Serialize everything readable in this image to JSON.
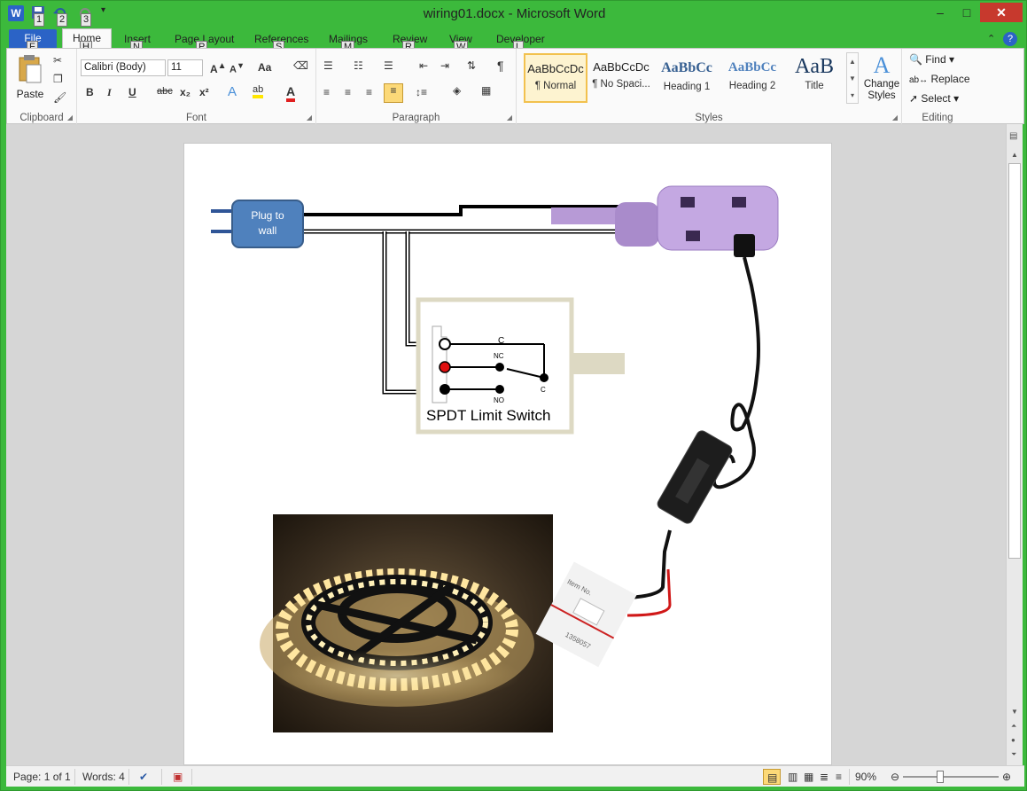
{
  "app": {
    "title": "wiring01.docx - Microsoft Word",
    "window_buttons": [
      "–",
      "□",
      "✕"
    ]
  },
  "qat": {
    "keytips": [
      "1",
      "2",
      "3"
    ]
  },
  "tabs": [
    {
      "label": "File",
      "keytip": "F"
    },
    {
      "label": "Home",
      "keytip": "H"
    },
    {
      "label": "Insert",
      "keytip": "N"
    },
    {
      "label": "Page Layout",
      "keytip": "P"
    },
    {
      "label": "References",
      "keytip": "S"
    },
    {
      "label": "Mailings",
      "keytip": "M"
    },
    {
      "label": "Review",
      "keytip": "R"
    },
    {
      "label": "View",
      "keytip": "W"
    },
    {
      "label": "Developer",
      "keytip": "L"
    }
  ],
  "ribbon": {
    "clipboard": {
      "label": "Clipboard",
      "paste": "Paste"
    },
    "font": {
      "label": "Font",
      "font_name": "Calibri (Body)",
      "font_size": "11",
      "case": "Aa"
    },
    "paragraph": {
      "label": "Paragraph"
    },
    "styles": {
      "label": "Styles",
      "items": [
        {
          "sample": "AaBbCcDc",
          "name": "¶ Normal"
        },
        {
          "sample": "AaBbCcDc",
          "name": "¶ No Spaci..."
        },
        {
          "sample": "AaBbCc",
          "name": "Heading 1"
        },
        {
          "sample": "AaBbCc",
          "name": "Heading 2"
        },
        {
          "sample": "AaB",
          "name": "Title"
        }
      ],
      "change_styles": "Change Styles"
    },
    "editing": {
      "label": "Editing",
      "find": "Find",
      "replace": "Replace",
      "select": "Select"
    }
  },
  "document": {
    "plug_label_line1": "Plug to",
    "plug_label_line2": "wall",
    "switch_label": "SPDT Limit Switch",
    "terminal_c": "C",
    "terminal_nc": "NC",
    "terminal_no": "NO",
    "terminal_c2": "C",
    "connector_text1": "Item No.",
    "connector_text2": "1358057"
  },
  "status": {
    "page": "Page: 1 of 1",
    "words": "Words: 4",
    "zoom": "90%"
  },
  "colors": {
    "title_green": "#3cb93c",
    "file_tab": "#2b63c6",
    "plug_fill": "#4f81bd",
    "outlet_purple": "#b79ad6",
    "switch_frame": "#ddd9c3"
  }
}
